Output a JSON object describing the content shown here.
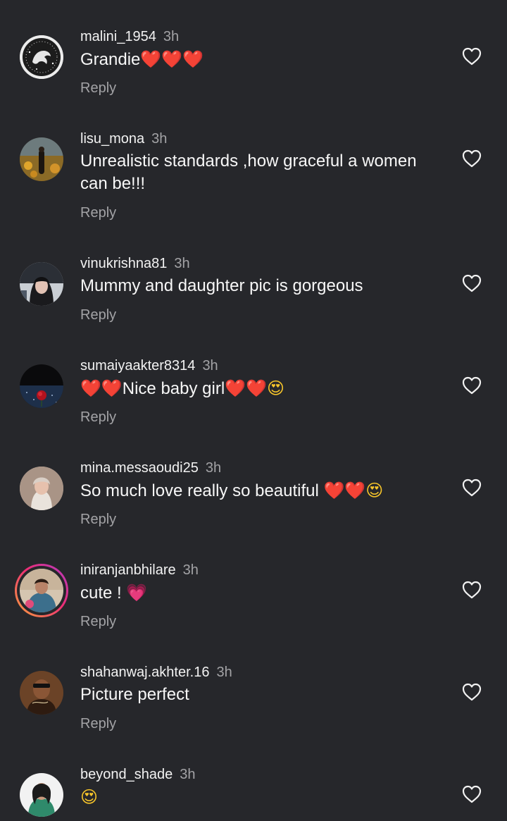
{
  "comments": [
    {
      "username": "malini_1954",
      "time": "3h",
      "text": "Grandie",
      "emoji": "❤️❤️❤️",
      "reply": "Reply"
    },
    {
      "username": "lisu_mona",
      "time": "3h",
      "text_line1": "Unrealistic standards ,how graceful a women",
      "text_line2": "can be!!!",
      "reply": "Reply"
    },
    {
      "username": "vinukrishna81",
      "time": "3h",
      "text": "Mummy and daughter pic is gorgeous",
      "reply": "Reply"
    },
    {
      "username": "sumaiyaakter8314",
      "time": "3h",
      "emoji_before": "❤️❤️",
      "text": "Nice baby girl",
      "emoji_after": "❤️❤️",
      "emoji_face": "😍",
      "reply": "Reply"
    },
    {
      "username": "mina.messaoudi25",
      "time": "3h",
      "text": "So much love really so beautiful ",
      "emoji": "❤️❤️",
      "emoji_face": "😍",
      "reply": "Reply"
    },
    {
      "username": "iniranjanbhilare",
      "time": "3h",
      "text": "cute ! ",
      "emoji": "💗",
      "reply": "Reply"
    },
    {
      "username": "shahanwaj.akhter.16",
      "time": "3h",
      "text": "Picture perfect",
      "reply": "Reply"
    },
    {
      "username": "beyond_shade",
      "time": "3h",
      "emoji_face": "😍"
    }
  ],
  "icons": {
    "like": "heart-outline-icon"
  },
  "colors": {
    "background": "#26272b",
    "text_primary": "#f7f7f7",
    "text_secondary": "#a3a3a6",
    "heart_red": "#e8212e"
  }
}
